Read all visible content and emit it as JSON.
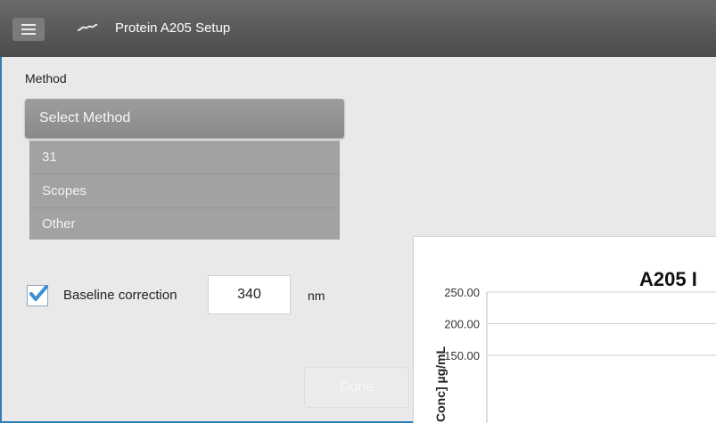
{
  "titlebar": {
    "title": "Protein A205 Setup",
    "menu_icon": "hamburger-menu-icon",
    "app_icon": "wave-icon"
  },
  "method": {
    "label": "Method",
    "select_label": "Select Method",
    "options": [
      "31",
      "Scopes",
      "Other"
    ]
  },
  "baseline": {
    "checked": true,
    "label": "Baseline correction",
    "value": "340",
    "unit": "nm"
  },
  "done_label": "Done",
  "chart_data": {
    "type": "line",
    "title": "A205 I",
    "ylabel": "Conc] µg/mL",
    "yticks": [
      "250.00",
      "200.00",
      "150.00"
    ],
    "ylim": [
      150,
      250
    ],
    "grid": true
  }
}
